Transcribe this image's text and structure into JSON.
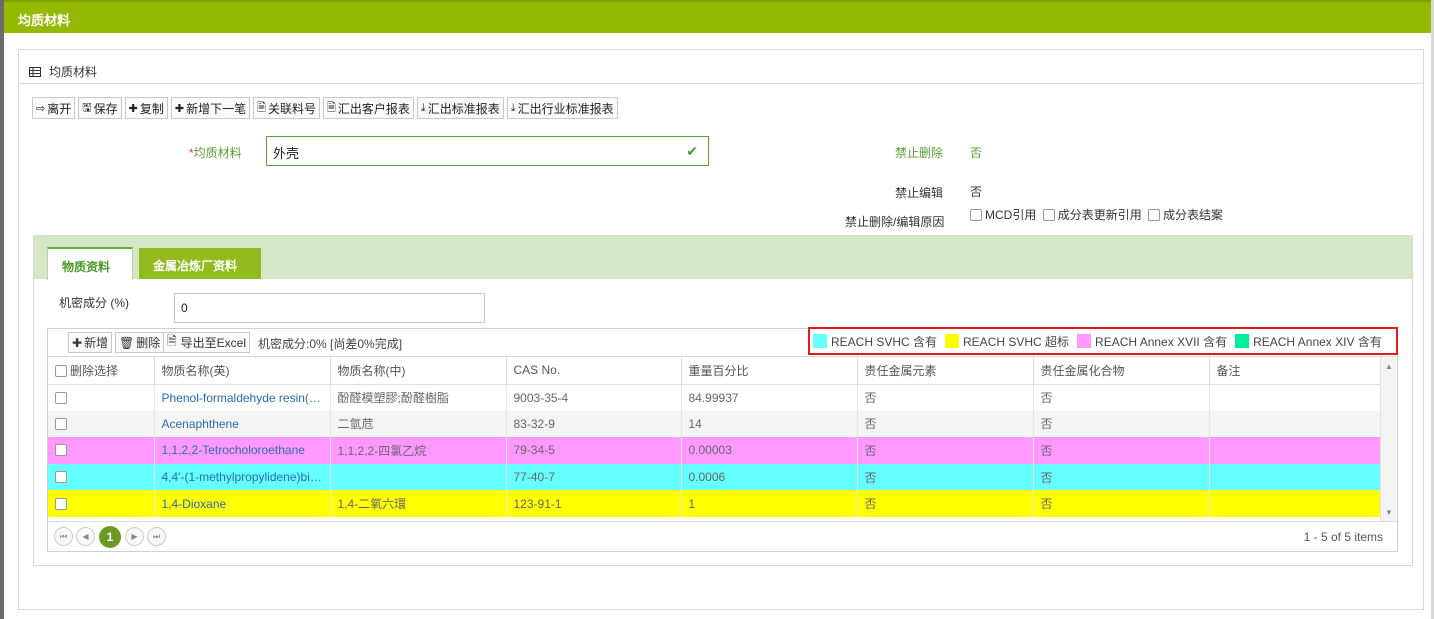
{
  "window": {
    "title": "均质材料"
  },
  "panel": {
    "title": "均质材料"
  },
  "toolbar": {
    "leave": "离开",
    "save": "保存",
    "copy": "复制",
    "add_next": "新增下一笔",
    "link_part": "关联料号",
    "export_customer": "汇出客户报表",
    "export_standard": "汇出标准报表",
    "export_industry": "汇出行业标准报表"
  },
  "form": {
    "material_label": "均质材料",
    "material_value": "外壳",
    "forbid_delete_label": "禁止删除",
    "forbid_delete_value": "否",
    "forbid_edit_label": "禁止编辑",
    "forbid_edit_value": "否",
    "reason_label": "禁止删除/编辑原因",
    "reasons": [
      "MCD引用",
      "成分表更新引用",
      "成分表结案"
    ]
  },
  "tabs": [
    {
      "label": "物质资料"
    },
    {
      "label": "金属冶炼厂资料"
    }
  ],
  "secret": {
    "label": "机密成分 (%)",
    "value": "0"
  },
  "grid_toolbar": {
    "add": "新增",
    "delete": "删除",
    "export_excel": "导出至Excel",
    "status": "机密成分:0% [尚差0%完成]"
  },
  "legend": [
    {
      "label": "REACH SVHC 含有",
      "color": "#66ffff"
    },
    {
      "label": "REACH SVHC 超标",
      "color": "#ffff00"
    },
    {
      "label": "REACH Annex XVII 含有",
      "color": "#ff99ff"
    },
    {
      "label": "REACH Annex XIV 含有",
      "color": "#00ee99"
    }
  ],
  "table": {
    "columns": [
      "删除选择",
      "物质名称(英)",
      "物质名称(中)",
      "CAS No.",
      "重量百分比",
      "责任金属元素",
      "责任金属化合物",
      "备注"
    ],
    "rows": [
      {
        "en": "Phenol-formaldehyde resin(…",
        "zh": "酚醛模塑膠;酚醛樹脂",
        "cas": "9003-35-4",
        "weight": "84.99937",
        "metal": "否",
        "compound": "否",
        "note": ""
      },
      {
        "en": "Acenaphthene",
        "zh": "二氫苊",
        "cas": "83-32-9",
        "weight": "14",
        "metal": "否",
        "compound": "否",
        "note": ""
      },
      {
        "en": "1,1,2,2-Tetrocholoroethane",
        "zh": "1,1,2,2-四氯乙烷",
        "cas": "79-34-5",
        "weight": "0.00003",
        "metal": "否",
        "compound": "否",
        "note": ""
      },
      {
        "en": "4,4'-(1-methylpropylidene)bi…",
        "zh": "",
        "cas": "77-40-7",
        "weight": "0.0006",
        "metal": "否",
        "compound": "否",
        "note": ""
      },
      {
        "en": "1,4-Dioxane",
        "zh": "1,4-二氧六環",
        "cas": "123-91-1",
        "weight": "1",
        "metal": "否",
        "compound": "否",
        "note": ""
      }
    ]
  },
  "pager": {
    "current": "1",
    "info": "1 - 5 of 5 items"
  }
}
